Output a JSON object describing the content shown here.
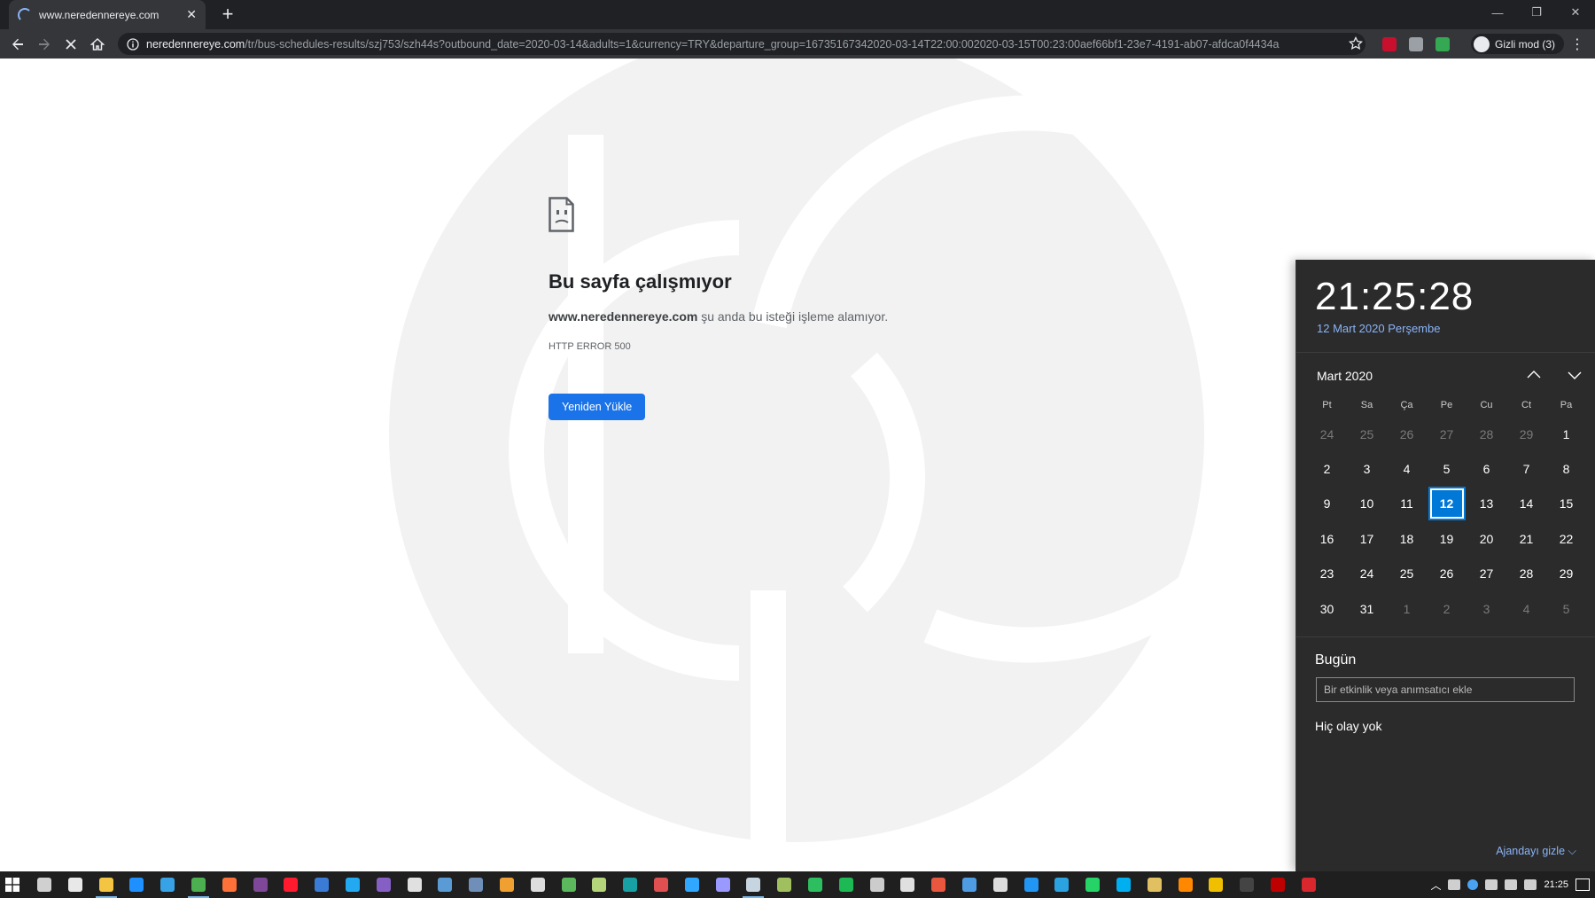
{
  "browser": {
    "tab_title": "www.neredennereye.com",
    "url_domain": "neredennereye.com",
    "url_rest": "/tr/bus-schedules-results/szj753/szh44s?outbound_date=2020-03-14&adults=1&currency=TRY&departure_group=16735167342020-03-14T22:00:002020-03-15T00:23:00aef66bf1-23e7-4191-ab07-afdca0f4434a",
    "profile_label": "Gizli mod (3)",
    "extensions": [
      {
        "name": "adblock-plus-extension",
        "color": "#c8102e"
      },
      {
        "name": "screen-capture-extension",
        "color": "#9aa0a6"
      },
      {
        "name": "green-extension",
        "color": "#34a853"
      }
    ]
  },
  "error_page": {
    "title": "Bu sayfa çalışmıyor",
    "domain": "www.neredennereye.com",
    "description": " şu anda bu isteği işleme alamıyor.",
    "code": "HTTP ERROR 500",
    "reload_label": "Yeniden Yükle"
  },
  "calendar": {
    "time": "21:25:28",
    "date_long": "12 Mart 2020 Perşembe",
    "month_label": "Mart 2020",
    "weekdays": [
      "Pt",
      "Sa",
      "Ça",
      "Pe",
      "Cu",
      "Ct",
      "Pa"
    ],
    "days": [
      {
        "d": "24",
        "dim": true
      },
      {
        "d": "25",
        "dim": true
      },
      {
        "d": "26",
        "dim": true
      },
      {
        "d": "27",
        "dim": true
      },
      {
        "d": "28",
        "dim": true
      },
      {
        "d": "29",
        "dim": true
      },
      {
        "d": "1"
      },
      {
        "d": "2"
      },
      {
        "d": "3"
      },
      {
        "d": "4"
      },
      {
        "d": "5"
      },
      {
        "d": "6"
      },
      {
        "d": "7"
      },
      {
        "d": "8"
      },
      {
        "d": "9"
      },
      {
        "d": "10"
      },
      {
        "d": "11"
      },
      {
        "d": "12",
        "today": true
      },
      {
        "d": "13"
      },
      {
        "d": "14"
      },
      {
        "d": "15"
      },
      {
        "d": "16"
      },
      {
        "d": "17"
      },
      {
        "d": "18"
      },
      {
        "d": "19"
      },
      {
        "d": "20"
      },
      {
        "d": "21"
      },
      {
        "d": "22"
      },
      {
        "d": "23"
      },
      {
        "d": "24"
      },
      {
        "d": "25"
      },
      {
        "d": "26"
      },
      {
        "d": "27"
      },
      {
        "d": "28"
      },
      {
        "d": "29"
      },
      {
        "d": "30"
      },
      {
        "d": "31"
      },
      {
        "d": "1",
        "dim": true
      },
      {
        "d": "2",
        "dim": true
      },
      {
        "d": "3",
        "dim": true
      },
      {
        "d": "4",
        "dim": true
      },
      {
        "d": "5",
        "dim": true
      }
    ],
    "today_header": "Bugün",
    "event_placeholder": "Bir etkinlik veya anımsatıcı ekle",
    "no_events": "Hiç olay yok",
    "hide_agenda": "Ajandayı gizle"
  },
  "taskbar": {
    "clock": "21:25",
    "apps": [
      {
        "name": "task-view-icon",
        "color": "#d0d0d0"
      },
      {
        "name": "store-icon",
        "color": "#e8e8e8"
      },
      {
        "name": "file-explorer-icon",
        "color": "#f4c542",
        "active": true
      },
      {
        "name": "edge-icon",
        "color": "#1e90ff"
      },
      {
        "name": "internet-explorer-icon",
        "color": "#37a3e6"
      },
      {
        "name": "chrome-icon",
        "color": "#4caf50",
        "active": true
      },
      {
        "name": "firefox-icon",
        "color": "#ff7139"
      },
      {
        "name": "tor-browser-icon",
        "color": "#7e4798"
      },
      {
        "name": "opera-icon",
        "color": "#ff1b2d"
      },
      {
        "name": "app-window-icon",
        "color": "#3a7bd5"
      },
      {
        "name": "vscode-icon",
        "color": "#23a9f2"
      },
      {
        "name": "visual-studio-icon",
        "color": "#865fc5"
      },
      {
        "name": "pycharm-icon",
        "color": "#e0e0e0"
      },
      {
        "name": "virtualbox-icon",
        "color": "#5a9bd5"
      },
      {
        "name": "notion-icon",
        "color": "#6f8fb8"
      },
      {
        "name": "star-app-icon",
        "color": "#f0a030"
      },
      {
        "name": "spark-app-icon",
        "color": "#dddddd"
      },
      {
        "name": "green-leaf-icon",
        "color": "#5cb85c"
      },
      {
        "name": "notepad-icon",
        "color": "#b5d57b"
      },
      {
        "name": "arduino-icon",
        "color": "#17a1a5"
      },
      {
        "name": "red-app-icon",
        "color": "#e05050"
      },
      {
        "name": "photoshop-icon",
        "color": "#31a8ff"
      },
      {
        "name": "premiere-icon",
        "color": "#9999ff"
      },
      {
        "name": "steam-app-icon",
        "color": "#c7d5e0",
        "active": true
      },
      {
        "name": "layers-icon",
        "color": "#a0c060"
      },
      {
        "name": "evernote-icon",
        "color": "#2dbe60"
      },
      {
        "name": "spotify-icon",
        "color": "#1db954"
      },
      {
        "name": "robot-icon",
        "color": "#cccccc"
      },
      {
        "name": "bird-app-icon",
        "color": "#e0e0e0"
      },
      {
        "name": "orange-app-icon",
        "color": "#e9573f"
      },
      {
        "name": "windows-app-icon",
        "color": "#4e9de4"
      },
      {
        "name": "obs-icon",
        "color": "#dddddd"
      },
      {
        "name": "box-app-icon",
        "color": "#2196f3"
      },
      {
        "name": "telegram-icon",
        "color": "#2aa3e0"
      },
      {
        "name": "whatsapp-icon",
        "color": "#25d366"
      },
      {
        "name": "skype-icon",
        "color": "#00aff0"
      },
      {
        "name": "folder-icon",
        "color": "#e0c060"
      },
      {
        "name": "vlc-icon",
        "color": "#ff8800"
      },
      {
        "name": "yellow-app-icon",
        "color": "#f0c000"
      },
      {
        "name": "terminal-icon",
        "color": "#444444"
      },
      {
        "name": "filezilla-icon",
        "color": "#bf0000"
      },
      {
        "name": "mega-icon",
        "color": "#d9272e"
      }
    ]
  }
}
